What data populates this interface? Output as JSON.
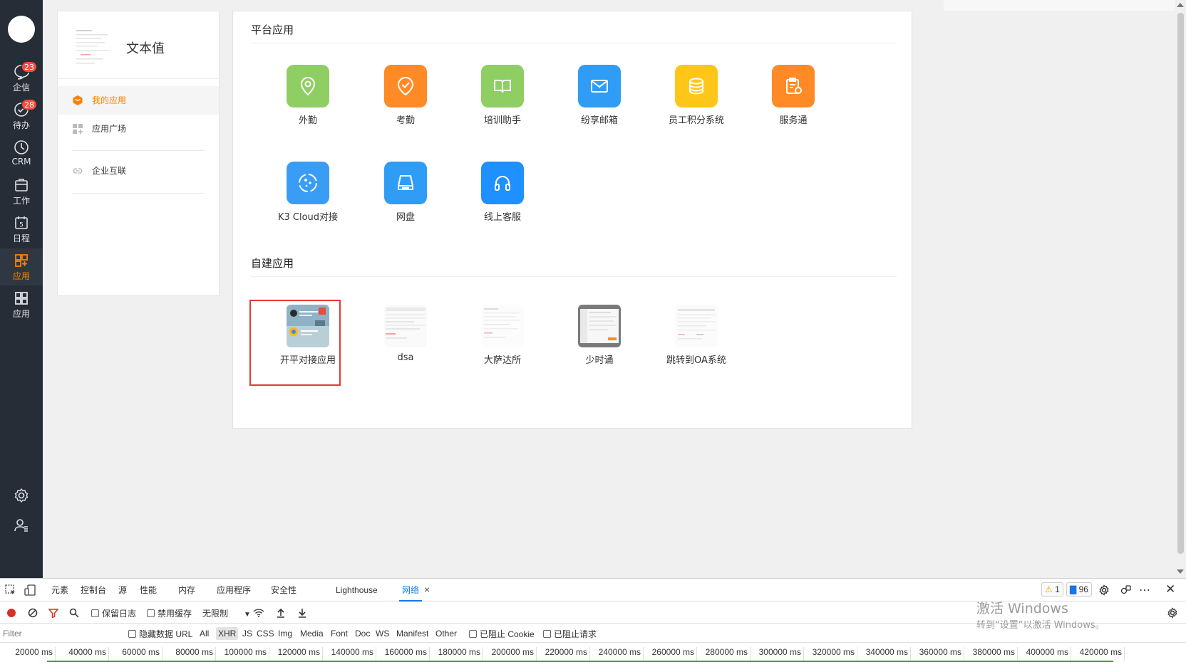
{
  "nav": {
    "items": [
      {
        "label": "企信",
        "badge": "23"
      },
      {
        "label": "待办",
        "badge": "28"
      },
      {
        "label": "CRM"
      },
      {
        "label": "工作"
      },
      {
        "label": "日程",
        "icon_text": "5"
      },
      {
        "label": "应用"
      },
      {
        "label": "应用"
      }
    ],
    "active_color": "#ff8000"
  },
  "side": {
    "company_name": "文本值",
    "items": [
      {
        "label": "我的应用"
      },
      {
        "label": "应用广场"
      },
      {
        "label": "企业互联"
      }
    ]
  },
  "main": {
    "platform_title": "平台应用",
    "platform_apps": [
      {
        "label": "外勤",
        "color": "#8fce63",
        "icon": "location-pin-icon"
      },
      {
        "label": "考勤",
        "color": "#ff8a26",
        "icon": "check-badge-icon"
      },
      {
        "label": "培训助手",
        "color": "#8fce63",
        "icon": "open-book-icon"
      },
      {
        "label": "纷享邮箱",
        "color": "#2f9df5",
        "icon": "mail-icon"
      },
      {
        "label": "员工积分系统",
        "color": "#ffc61a",
        "icon": "coin-stack-icon"
      },
      {
        "label": "服务通",
        "color": "#ff8a26",
        "icon": "service-clipboard-icon"
      },
      {
        "label": "K3 Cloud对接",
        "color": "#3a9df5",
        "icon": "cloud-dots-icon"
      },
      {
        "label": "网盘",
        "color": "#2f9df5",
        "icon": "drive-icon"
      },
      {
        "label": "线上客服",
        "color": "#1e90ff",
        "icon": "headset-icon"
      }
    ],
    "custom_title": "自建应用",
    "custom_apps": [
      {
        "label": "开平对接应用"
      },
      {
        "label": "dsa"
      },
      {
        "label": "大萨达所"
      },
      {
        "label": "少时诵"
      },
      {
        "label": "跳转到OA系统"
      }
    ]
  },
  "devtools": {
    "tabs": [
      "元素",
      "控制台",
      "源",
      "性能",
      "内存",
      "应用程序",
      "安全性",
      "Lighthouse",
      "网络"
    ],
    "active_tab": "网络",
    "warnings": "1",
    "messages": "96",
    "preserve_log": "保留日志",
    "disable_cache": "禁用缓存",
    "throttling": "无限制",
    "filter_placeholder": "Filter",
    "hide_data_urls": "隐藏数据 URL",
    "filters": [
      "All",
      "XHR",
      "JS",
      "CSS",
      "Img",
      "Media",
      "Font",
      "Doc",
      "WS",
      "Manifest",
      "Other"
    ],
    "active_filter": "XHR",
    "blocked_cookies": "已阻止 Cookie",
    "blocked_requests": "已阻止请求",
    "timeline": [
      "20000 ms",
      "40000 ms",
      "60000 ms",
      "80000 ms",
      "100000 ms",
      "120000 ms",
      "140000 ms",
      "160000 ms",
      "180000 ms",
      "200000 ms",
      "220000 ms",
      "240000 ms",
      "260000 ms",
      "280000 ms",
      "300000 ms",
      "320000 ms",
      "340000 ms",
      "360000 ms",
      "380000 ms",
      "400000 ms",
      "420000 ms"
    ]
  },
  "watermark": {
    "line1": "激活 Windows",
    "line2": "转到“设置”以激活 Windows。"
  }
}
